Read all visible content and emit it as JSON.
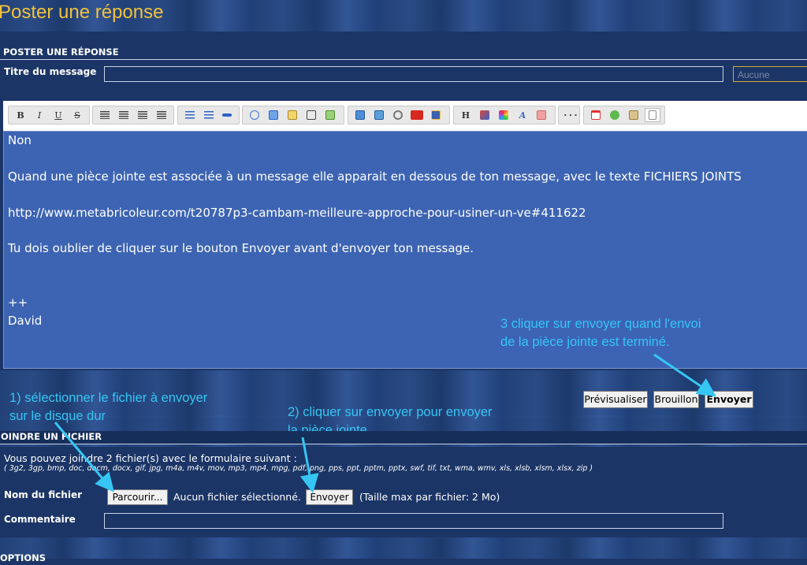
{
  "page_title": "Poster une réponse",
  "section_post": {
    "title": "POSTER UNE RÉPONSE"
  },
  "message_title": {
    "label": "Titre du message",
    "value": ""
  },
  "icon_select": {
    "selected": "Aucune"
  },
  "toolbar": {
    "groups": [
      [
        "bold-icon",
        "italic-icon",
        "underline-icon",
        "strikethrough-icon"
      ],
      [
        "align-left-icon",
        "align-center-icon",
        "align-right-icon",
        "justify-icon"
      ],
      [
        "bulleted-list-icon",
        "numbered-list-icon",
        "horizontal-rule-icon"
      ],
      [
        "quote-icon",
        "spoiler-icon",
        "file-icon",
        "edit-icon",
        "hidden-icon"
      ],
      [
        "image-icon",
        "image-upload-icon",
        "link-icon",
        "youtube-icon",
        "flash-icon"
      ],
      [
        "heading-icon",
        "font-icon",
        "color-icon",
        "font-style-icon",
        "eraser-icon"
      ],
      [
        "more-icon"
      ],
      [
        "date-icon",
        "add-icon",
        "paste-icon",
        "source-icon"
      ]
    ],
    "labels": {
      "bold": "B",
      "italic": "I",
      "underline": "U",
      "strike": "S",
      "heading": "H",
      "font": "A"
    }
  },
  "editor": {
    "lines": [
      "Non",
      "Quand une pièce jointe est associée à un message elle apparait en dessous de ton message, avec le texte FICHIERS JOINTS",
      "http://www.metabricoleur.com/t20787p3-cambam-meilleure-approche-pour-usiner-un-ve#411622",
      "Tu dois oublier de cliquer sur le bouton Envoyer avant d'envoyer ton message.",
      "++",
      "David"
    ]
  },
  "annotations": {
    "step3_line1": "3 cliquer sur envoyer quand l'envoi",
    "step3_line2": "de la pièce jointe est terminé.",
    "step1_line1": "1) sélectionner le fichier à envoyer",
    "step1_line2": "sur le disque dur",
    "step2_line1": "2) cliquer sur envoyer pour envoyer",
    "step2_line2": "la pièce jointe"
  },
  "action_buttons": {
    "preview": "Prévisualiser",
    "draft": "Brouillon",
    "send": "Envoyer"
  },
  "section_attach": {
    "title": "OINDRE UN FICHIER",
    "intro": "Vous pouvez joindre 2 fichier(s) avec le formulaire suivant :",
    "extensions": "( 3g2, 3gp, bmp, doc, docm, docx, gif, jpg, m4a, m4v, mov, mp3, mp4, mpg, pdf, png, pps, ppt, pptm, pptx, swf, tif, txt, wma, wmv, xls, xlsb, xlsm, xlsx, zip )",
    "file_label": "Nom du fichier",
    "browse": "Parcourir...",
    "no_file": "Aucun fichier sélectionné.",
    "upload": "Envoyer",
    "max_size": "(Taille max par fichier: 2 Mo)",
    "comment_label": "Commentaire",
    "comment_value": ""
  },
  "section_options": {
    "title": "OPTIONS"
  },
  "colors": {
    "title": "#f2c23a",
    "annotation": "#35c6f4",
    "editor_bg": "#3d64b3",
    "page_bg": "#1b3566"
  }
}
